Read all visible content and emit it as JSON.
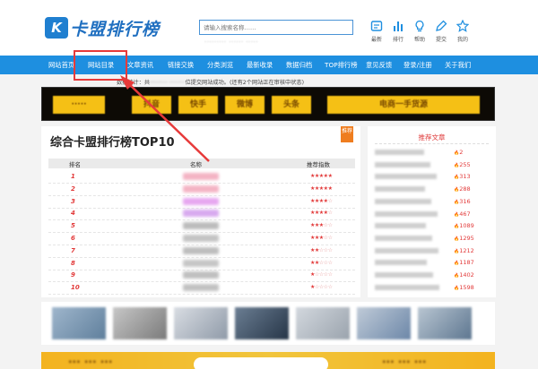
{
  "brand": {
    "badge": "K",
    "name": "卡盟排行榜"
  },
  "search": {
    "placeholder": "请输入搜索名称……",
    "hot_words": "·········  ······  ·····"
  },
  "icon_bar": [
    {
      "icon": "latest-icon",
      "label": "最新"
    },
    {
      "icon": "ranking-icon",
      "label": "排行"
    },
    {
      "icon": "help-icon",
      "label": "帮助"
    },
    {
      "icon": "submit-icon",
      "label": "提交"
    },
    {
      "icon": "mine-icon",
      "label": "我的"
    }
  ],
  "nav": [
    "网站首页",
    "网站目录",
    "文章资讯",
    "链接交换",
    "分类浏览",
    "最新收录",
    "数据归档",
    "TOP排行榜",
    "意见反馈",
    "登录/注册",
    "关于我们"
  ],
  "notice": {
    "prefix": "数据统计：共",
    "blurred": "·········· ·········",
    "suffix": "位提交网站成功。(还有2个网站正在审核中状态)"
  },
  "banner_chips": [
    "·····",
    "抖音",
    "快手",
    "微博",
    "头条",
    "电商一手货源"
  ],
  "ranking": {
    "title": "综合卡盟排行榜TOP10",
    "tag": "推荐",
    "columns": [
      "排名",
      "名称",
      "推荐指数"
    ],
    "rows": [
      {
        "rank": "1",
        "stars": 5
      },
      {
        "rank": "2",
        "stars": 5
      },
      {
        "rank": "3",
        "stars": 4
      },
      {
        "rank": "4",
        "stars": 4
      },
      {
        "rank": "5",
        "stars": 3
      },
      {
        "rank": "6",
        "stars": 3
      },
      {
        "rank": "7",
        "stars": 2
      },
      {
        "rank": "8",
        "stars": 2
      },
      {
        "rank": "9",
        "stars": 1
      },
      {
        "rank": "10",
        "stars": 1
      }
    ]
  },
  "recommended": {
    "title": "推荐文章",
    "items": [
      "2",
      "255",
      "313",
      "288",
      "316",
      "467",
      "1089",
      "1295",
      "1212",
      "1187",
      "1402",
      "1598"
    ]
  },
  "colors": {
    "nav": "#1e8fe0",
    "accent_red": "#e23a3a",
    "highlight_box": "#e73a3a",
    "tag_orange": "#ef7d1f"
  }
}
